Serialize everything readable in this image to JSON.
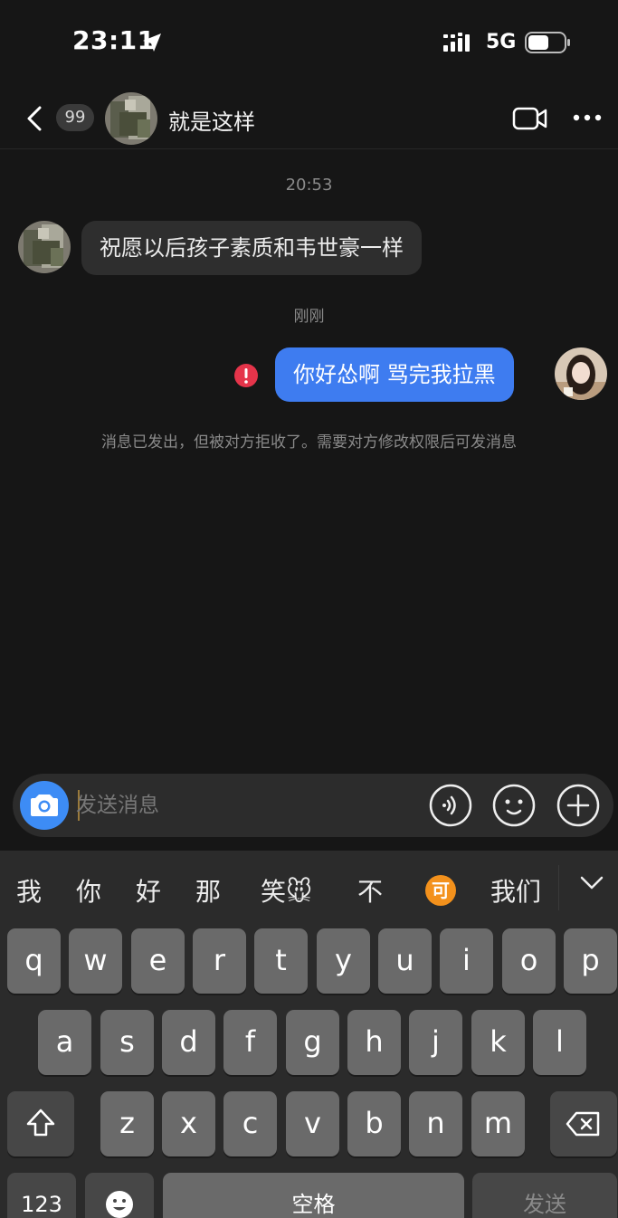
{
  "status_bar": {
    "time": "23:11",
    "network": "5G"
  },
  "header": {
    "unread_count": "99",
    "title": "就是这样"
  },
  "messages": {
    "timestamp_1": "20:53",
    "incoming_text": "祝愿以后孩子素质和韦世豪一样",
    "timestamp_2": "刚刚",
    "outgoing_text": "你好怂啊 骂完我拉黑",
    "notice": "消息已发出，但被对方拒收了。需要对方修改权限后可发消息"
  },
  "input": {
    "placeholder": "发送消息"
  },
  "keyboard": {
    "suggestions": [
      "我",
      "你",
      "好",
      "那",
      "笑🐭",
      "不",
      "可",
      "我们"
    ],
    "row1": [
      "q",
      "w",
      "e",
      "r",
      "t",
      "y",
      "u",
      "i",
      "o",
      "p"
    ],
    "row2": [
      "a",
      "s",
      "d",
      "f",
      "g",
      "h",
      "j",
      "k",
      "l"
    ],
    "row3": [
      "z",
      "x",
      "c",
      "v",
      "b",
      "n",
      "m"
    ],
    "numbers_label": "123",
    "space_label": "空格",
    "send_label": "发送"
  },
  "colors": {
    "outgoing_bubble": "#3e7cf0",
    "incoming_bubble": "#2e2e2e",
    "error": "#e5344a",
    "camera": "#3d8cf5",
    "suggestion_badge": "#f3911c"
  },
  "icons": [
    "location-icon",
    "signal-icon",
    "battery-icon",
    "back-icon",
    "video-call-icon",
    "more-icon",
    "error-icon",
    "camera-icon",
    "voice-icon",
    "emoji-icon",
    "plus-icon",
    "collapse-icon",
    "shift-icon",
    "backspace-icon",
    "emoji-key-icon"
  ]
}
